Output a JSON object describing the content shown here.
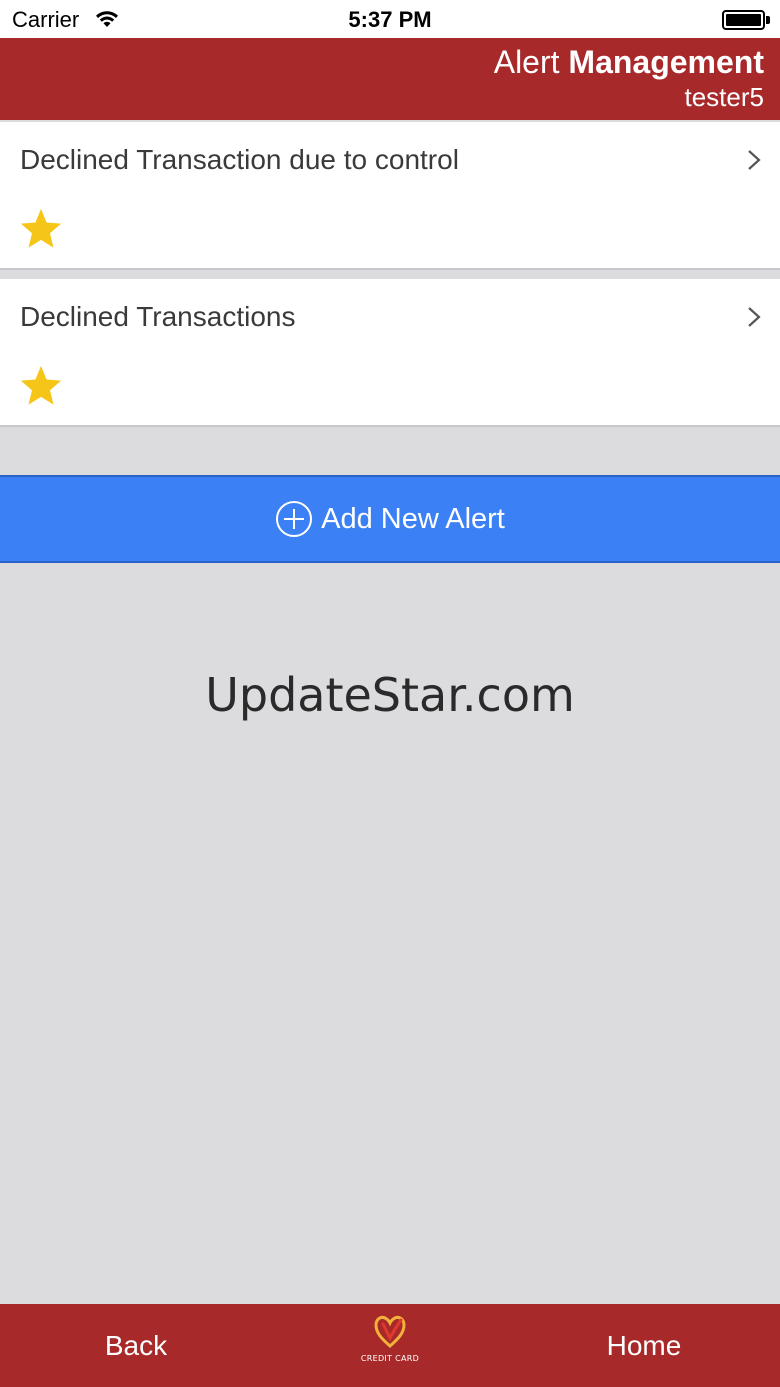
{
  "status_bar": {
    "carrier": "Carrier",
    "time": "5:37 PM"
  },
  "header": {
    "title_light": "Alert",
    "title_bold": "Management",
    "username": "tester5"
  },
  "alerts": [
    {
      "name": "Declined Transaction due to control",
      "favorite": true
    },
    {
      "name": "Declined Transactions",
      "favorite": true
    }
  ],
  "add_button": {
    "label": "Add New Alert",
    "icon": "plus-circle-icon"
  },
  "watermark": "UpdateStar.com",
  "bottom_bar": {
    "back_label": "Back",
    "logo_text": "CREDIT CARD",
    "home_label": "Home"
  },
  "colors": {
    "brand_red": "#a8292a",
    "action_blue": "#3b80f5",
    "star_gold": "#f5c518",
    "background": "#dcdcdf"
  }
}
